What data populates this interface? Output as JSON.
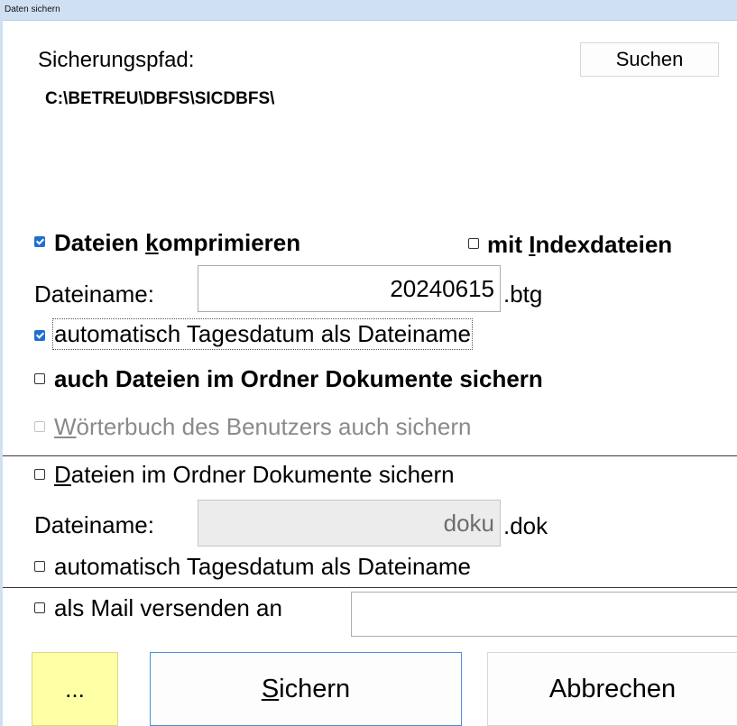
{
  "window": {
    "title": "Daten sichern"
  },
  "path": {
    "label": "Sicherungspfad:",
    "value": "C:\\BETREU\\DBFS\\SICDBFS\\",
    "search_button": "Suchen"
  },
  "compress": {
    "checked": true,
    "label_pre": "Dateien ",
    "label_key": "k",
    "label_post": "omprimieren",
    "index_checked": false,
    "index_label_pre": "mit ",
    "index_label_key": "I",
    "index_label_post": "ndexdateien"
  },
  "backup_file": {
    "label": "Dateiname:",
    "value": "20240615",
    "extension": ".btg",
    "auto_date_checked": true,
    "auto_date_label": "automatisch Tagesdatum als Dateiname",
    "include_documents_checked": false,
    "include_documents_label": "auch Dateien im Ordner Dokumente sichern",
    "dictionary_checked": false,
    "dictionary_label_key": "W",
    "dictionary_label_post": "örterbuch des Benutzers auch sichern"
  },
  "documents": {
    "checked": false,
    "label_key": "D",
    "label_post": "ateien im Ordner Dokumente sichern",
    "file_label": "Dateiname:",
    "file_value": "doku",
    "extension": ".dok",
    "auto_date_checked": false,
    "auto_date_label": "automatisch Tagesdatum als Dateiname"
  },
  "mail": {
    "checked": false,
    "label": "als Mail versenden an",
    "value": ""
  },
  "buttons": {
    "more": "...",
    "save_key": "S",
    "save_post": "ichern",
    "cancel": "Abbrechen"
  },
  "colors": {
    "accent": "#1e6fd0",
    "titlebar": "#cfe0f3",
    "more_button": "#ffffa6",
    "save_border": "#4d8fd6"
  }
}
